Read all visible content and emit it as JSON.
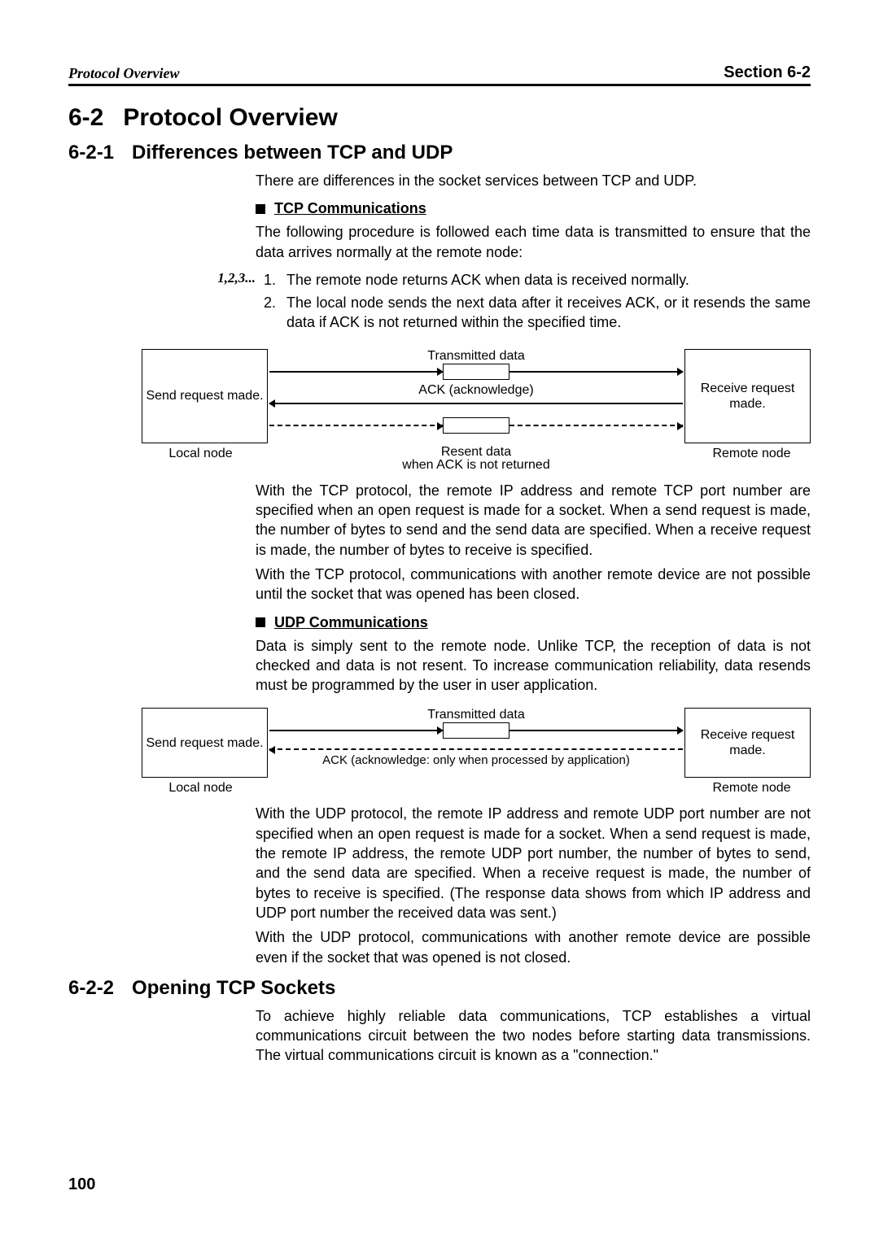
{
  "header": {
    "running_head": "Protocol Overview",
    "section_ref": "Section 6-2"
  },
  "h1": {
    "num": "6-2",
    "title": "Protocol Overview"
  },
  "s1": {
    "num": "6-2-1",
    "title": "Differences between TCP and UDP",
    "intro": "There are differences in the socket services between TCP and UDP.",
    "tcp_head": "TCP Communications",
    "tcp_intro": "The following procedure is followed each time data is transmitted to ensure that the data arrives normally at the remote node:",
    "steps_label": "1,2,3...",
    "steps": [
      {
        "n": "1.",
        "t": "The remote node returns ACK when data is received normally."
      },
      {
        "n": "2.",
        "t": "The local node sends the next data after it receives ACK, or it resends the same data if ACK is not returned within the specified time."
      }
    ],
    "tcp_diag": {
      "left_box": "Send request made.",
      "right_box": "Receive request made.",
      "row1_label": "Transmitted data",
      "row2_label": "ACK (acknowledge)",
      "row3_label_a": "Resent data",
      "row3_label_b": "when ACK is not returned",
      "left_cap": "Local node",
      "right_cap": "Remote node"
    },
    "tcp_p1": "With the TCP protocol, the remote IP address and remote TCP port number are specified when an open request is made for a socket. When a send request is made, the number of bytes to send and the send data are specified. When a receive request is made, the number of bytes to receive is specified.",
    "tcp_p2": "With the TCP protocol, communications with another remote device are not possible until the socket that was opened has been closed.",
    "udp_head": "UDP Communications",
    "udp_intro": "Data is simply sent to the remote node. Unlike TCP, the reception of data is not checked and data is not resent. To increase communication reliability, data resends must be programmed by the user in user application.",
    "udp_diag": {
      "left_box": "Send request made.",
      "right_box": "Receive request made.",
      "row1_label": "Transmitted data",
      "row2_label": "ACK (acknowledge: only when processed by application)",
      "left_cap": "Local node",
      "right_cap": "Remote node"
    },
    "udp_p1": "With the UDP protocol, the remote IP address and remote UDP port number are not specified when an open request is made for a socket. When a send request is made, the remote IP address, the remote UDP port number, the number of bytes to send, and the send data are specified. When a receive request is made, the number of bytes to receive is specified. (The response data shows from which IP address and UDP port number the received data was sent.)",
    "udp_p2": "With the UDP protocol, communications with another remote device are possible even if the socket that was opened is not closed."
  },
  "s2": {
    "num": "6-2-2",
    "title": "Opening TCP Sockets",
    "p1": "To achieve highly reliable data communications, TCP establishes a virtual communications circuit between the two nodes before starting data transmissions. The virtual communications circuit is known as a \"connection.\""
  },
  "page_number": "100"
}
